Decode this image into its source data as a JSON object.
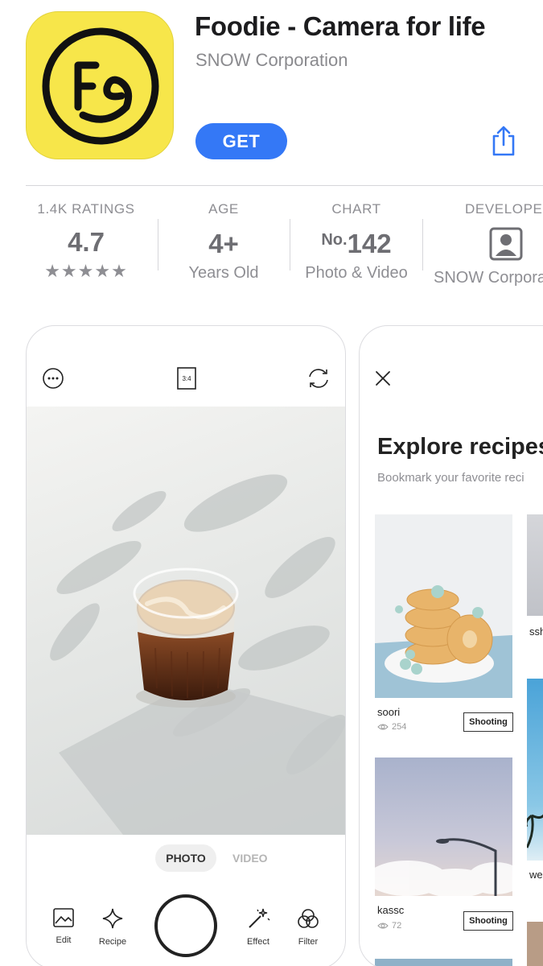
{
  "app": {
    "title": "Foodie - Camera for life",
    "developer": "SNOW Corporation",
    "get_label": "GET",
    "accent": "#3478f6",
    "icon_color": "#f7e64a"
  },
  "info": {
    "ratings": {
      "label": "1.4K RATINGS",
      "value": "4.7",
      "stars": "★★★★★"
    },
    "age": {
      "label": "AGE",
      "value": "4+",
      "sub": "Years Old"
    },
    "chart": {
      "label": "CHART",
      "prefix": "No.",
      "value": "142",
      "sub": "Photo & Video"
    },
    "developer": {
      "label": "DEVELOPER",
      "sub": "SNOW Corpora"
    }
  },
  "screen1": {
    "ratio_label": "3:4",
    "mode_photo": "PHOTO",
    "mode_video": "VIDEO",
    "tools": {
      "edit": "Edit",
      "recipe": "Recipe",
      "effect": "Effect",
      "filter": "Filter"
    }
  },
  "screen2": {
    "title": "Explore recipes",
    "subtitle": "Bookmark your favorite reci",
    "recipes": [
      {
        "user": "soori",
        "views": "254",
        "button": "Shooting"
      },
      {
        "user": "kassc",
        "views": "72",
        "button": "Shooting"
      }
    ],
    "right_users": [
      "ssh",
      "we"
    ]
  }
}
